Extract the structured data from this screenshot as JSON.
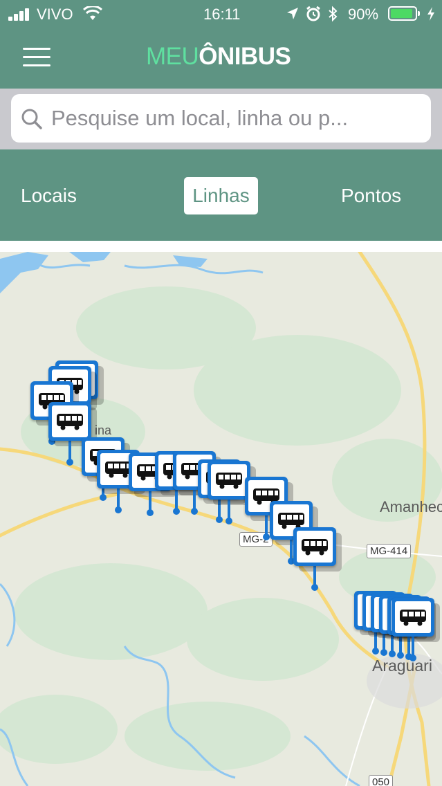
{
  "status": {
    "carrier": "VIVO",
    "time": "16:11",
    "battery_percent": "90%",
    "battery_level": 0.9,
    "icons": [
      "signal-icon",
      "wifi-icon",
      "location-arrow-icon",
      "alarm-icon",
      "bluetooth-icon",
      "battery-icon",
      "charging-icon"
    ]
  },
  "header": {
    "logo_part1": "MEU",
    "logo_part2": "ÔNIBUS",
    "menu_icon": "hamburger-menu-icon"
  },
  "search": {
    "placeholder": "Pesquise um local, linha ou p...",
    "value": "",
    "icon": "search-icon"
  },
  "tabs": [
    {
      "label": "Locais",
      "active": false
    },
    {
      "label": "Linhas",
      "active": true
    },
    {
      "label": "Pontos",
      "active": false
    }
  ],
  "map": {
    "labels": {
      "city_right": "Amanhec",
      "city_bottom": "Araguari",
      "partial_city": "ina"
    },
    "road_badges": {
      "mg_left": "MG-2",
      "mg_414": "MG-414",
      "route_050": "050"
    },
    "marker_icon": "bus-stop-marker-icon",
    "marker_count": 20
  },
  "colors": {
    "header_green": "#5e9483",
    "logo_accent": "#5fe0a0",
    "marker_blue": "#1976d2",
    "search_bg": "#c9c9ce",
    "road_yellow": "#f6d87a",
    "water_blue": "#8ec6f0"
  }
}
